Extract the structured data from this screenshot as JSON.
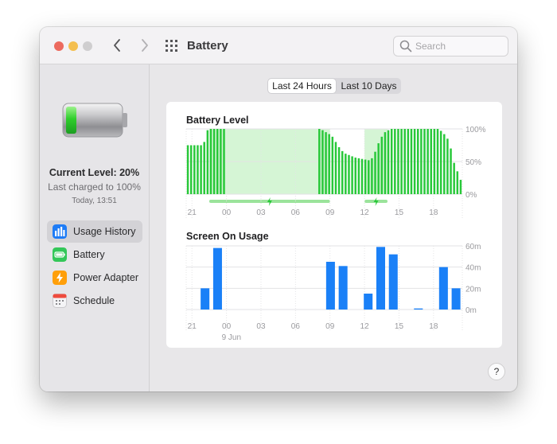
{
  "window": {
    "title": "Battery",
    "search_placeholder": "Search",
    "help_label": "?"
  },
  "sidebar": {
    "current_level": "Current Level: 20%",
    "last_charged": "Last charged to 100%",
    "timestamp": "Today, 13:51",
    "items": [
      {
        "label": "Usage History",
        "icon": "usage-history-icon",
        "color": "#1e7cf6",
        "selected": true
      },
      {
        "label": "Battery",
        "icon": "battery-icon",
        "color": "#34c759",
        "selected": false
      },
      {
        "label": "Power Adapter",
        "icon": "power-adapter-icon",
        "color": "#ff9f0a",
        "selected": false
      },
      {
        "label": "Schedule",
        "icon": "schedule-icon",
        "color": "#e9e9ec",
        "selected": false
      }
    ]
  },
  "tabs": {
    "active": "Last 24 Hours",
    "inactive": "Last 10 Days"
  },
  "chart_data": [
    {
      "type": "bar",
      "title": "Battery Level",
      "color": "#28c839",
      "charging_shade_color": "#d5f5d5",
      "y_ticks": [
        "100%",
        "50%",
        "0%"
      ],
      "ylim": [
        0,
        100
      ],
      "x_ticks": [
        "21",
        "00",
        "03",
        "06",
        "09",
        "12",
        "15",
        "18"
      ],
      "values": [
        75,
        75,
        75,
        75,
        75,
        80,
        98,
        100,
        100,
        100,
        100,
        100,
        0,
        0,
        0,
        0,
        0,
        0,
        0,
        0,
        0,
        0,
        0,
        0,
        0,
        0,
        0,
        0,
        0,
        0,
        0,
        0,
        0,
        0,
        0,
        0,
        0,
        0,
        0,
        0,
        100,
        98,
        95,
        92,
        88,
        80,
        72,
        66,
        62,
        60,
        58,
        56,
        55,
        54,
        53,
        52,
        55,
        65,
        78,
        88,
        95,
        98,
        100,
        100,
        100,
        100,
        100,
        100,
        100,
        100,
        100,
        100,
        100,
        100,
        100,
        100,
        100,
        97,
        92,
        85,
        70,
        48,
        35,
        22
      ],
      "charging_periods": [
        [
          "22:30",
          "09:00"
        ],
        [
          "12:00",
          "14:00"
        ]
      ]
    },
    {
      "type": "bar",
      "title": "Screen On Usage",
      "color": "#1a80f7",
      "y_ticks": [
        "60m",
        "40m",
        "20m",
        "0m"
      ],
      "ylim": [
        0,
        60
      ],
      "x_ticks": [
        "21",
        "00",
        "03",
        "06",
        "09",
        "12",
        "15",
        "18"
      ],
      "date_label": "9 Jun",
      "values": [
        0,
        20,
        58,
        0,
        0,
        0,
        0,
        0,
        0,
        0,
        0,
        45,
        41,
        0,
        15,
        59,
        52,
        0,
        1,
        0,
        40,
        20
      ]
    }
  ]
}
